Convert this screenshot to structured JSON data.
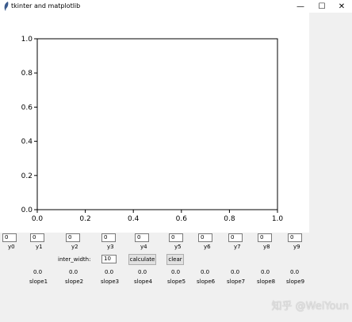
{
  "window": {
    "title": "tkinter and matplotlib",
    "minimize_glyph": "—",
    "maximize_glyph": "☐",
    "close_glyph": "✕"
  },
  "chart_data": {
    "type": "line",
    "series": [],
    "xlim": [
      0.0,
      1.0
    ],
    "ylim": [
      0.0,
      1.0
    ],
    "x_ticks": [
      "0.0",
      "0.2",
      "0.4",
      "0.6",
      "0.8",
      "1.0"
    ],
    "y_ticks": [
      "0.0",
      "0.2",
      "0.4",
      "0.6",
      "0.8",
      "1.0"
    ],
    "grid": false
  },
  "inputs": {
    "y_values": [
      "0",
      "0",
      "0",
      "0",
      "0",
      "0",
      "0",
      "0",
      "0",
      "0"
    ],
    "y_labels": [
      "y0",
      "y1",
      "y2",
      "y3",
      "y4",
      "y5",
      "y6",
      "y7",
      "y8",
      "y9"
    ]
  },
  "controls": {
    "inter_width_label": "inter_width:",
    "inter_width_value": "10",
    "calculate_label": "calculate",
    "clear_label": "clear"
  },
  "slopes": {
    "values": [
      "0.0",
      "0.0",
      "0.0",
      "0.0",
      "0.0",
      "0.0",
      "0.0",
      "0.0",
      "0.0"
    ],
    "labels": [
      "slope1",
      "slope2",
      "slope3",
      "slope4",
      "slope5",
      "slope6",
      "slope7",
      "slope8",
      "slope9"
    ]
  },
  "watermark": "知乎 @WeiYoun"
}
